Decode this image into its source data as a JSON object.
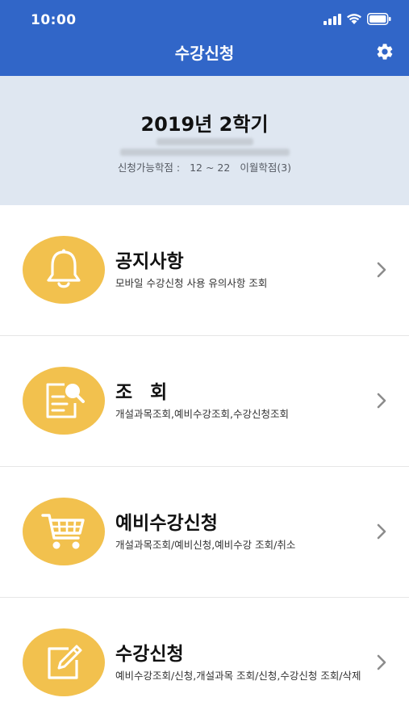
{
  "status_bar": {
    "time": "10:00"
  },
  "nav": {
    "title": "수강신청",
    "settings_icon": "gear-icon"
  },
  "semester": {
    "title": "2019년 2학기",
    "credits_label": "신청가능학점 :",
    "credits_range": "12 ~ 22",
    "carryover": "이월학점(3)"
  },
  "menu": [
    {
      "title": "공지사항",
      "subtitle": "모바일 수강신청 사용 유의사항 조회",
      "icon": "bell-icon"
    },
    {
      "title": "조회",
      "subtitle": "개설과목조회,예비수강조회,수강신청조회",
      "icon": "search-document-icon"
    },
    {
      "title": "예비수강신청",
      "subtitle": "개설과목조회/예비신청,예비수강 조회/취소",
      "icon": "cart-icon"
    },
    {
      "title": "수강신청",
      "subtitle": "예비수강조회/신청,개설과목 조회/신청,수강신청 조회/삭제",
      "icon": "edit-icon"
    }
  ],
  "colors": {
    "header": "#3166c8",
    "panel": "#dfe7f1",
    "icon_circle": "#f2c14e"
  }
}
